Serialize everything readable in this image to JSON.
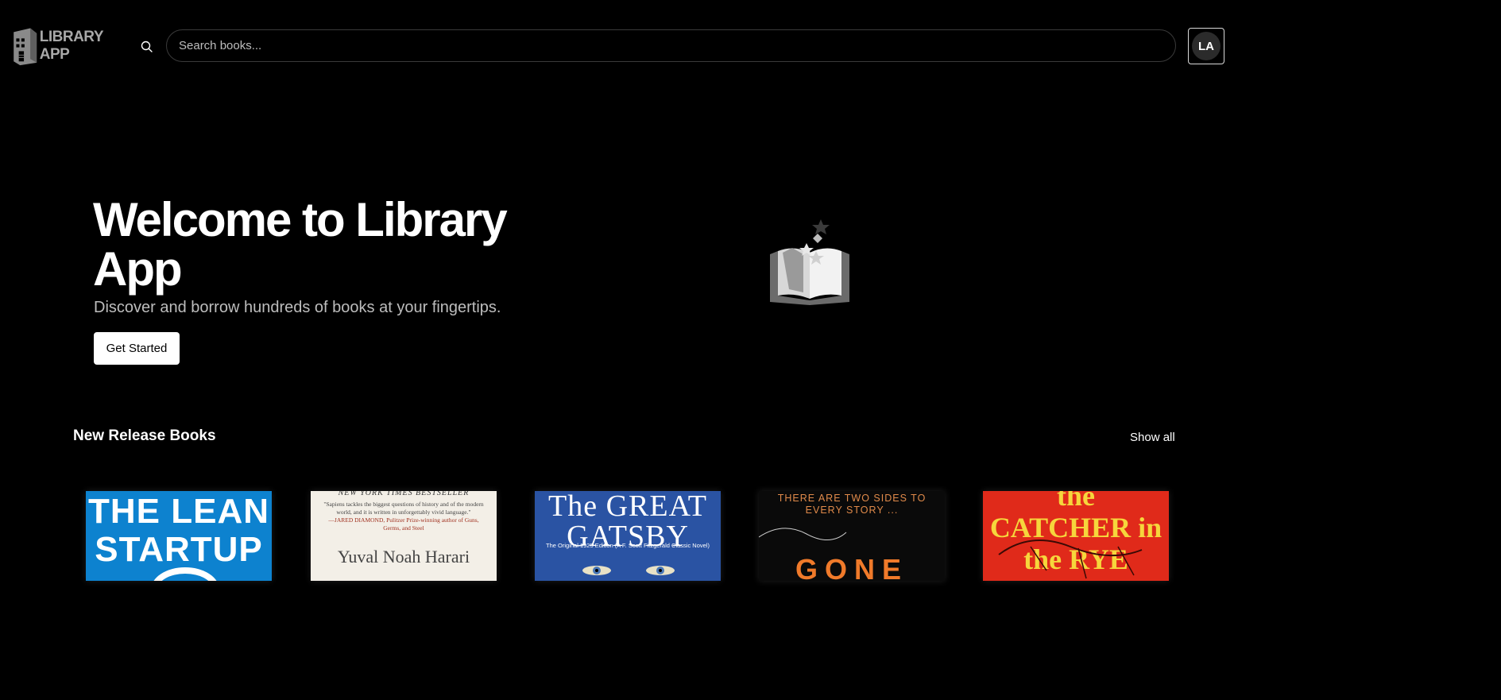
{
  "app": {
    "logo_line1": "LIBRARY",
    "logo_line2": "APP"
  },
  "search": {
    "placeholder": "Search books...",
    "value": ""
  },
  "user": {
    "initials": "LA"
  },
  "hero": {
    "title": "Welcome to Library App",
    "subtitle": "Discover and borrow hundreds of books at your fingertips.",
    "cta_label": "Get Started"
  },
  "new_releases": {
    "heading": "New Release Books",
    "show_all_label": "Show all",
    "books": [
      {
        "cover_title": "THE LEAN STARTUP"
      },
      {
        "cover_banner": "NEW YORK TIMES BESTSELLER",
        "cover_quote": "\"Sapiens tackles the biggest questions of history and of the modern world, and it is written in unforgettably vivid language.\"",
        "cover_quote_attribution": "—JARED DIAMOND, Pulitzer Prize-winning author of Guns, Germs, and Steel",
        "cover_author": "Yuval Noah Harari"
      },
      {
        "cover_title": "The GREAT GATSBY",
        "cover_subtitle": "The Original 1925 Edition (A F. Scott Fitzgerald Classic Novel)"
      },
      {
        "cover_tagline": "THERE ARE TWO SIDES TO EVERY STORY ...",
        "cover_title": "GONE"
      },
      {
        "cover_title": "the CATCHER in the RYE"
      }
    ]
  },
  "colors": {
    "background": "#000000",
    "text": "#ffffff",
    "muted_text": "#bdbdbd",
    "cta_bg": "#ffffff"
  }
}
